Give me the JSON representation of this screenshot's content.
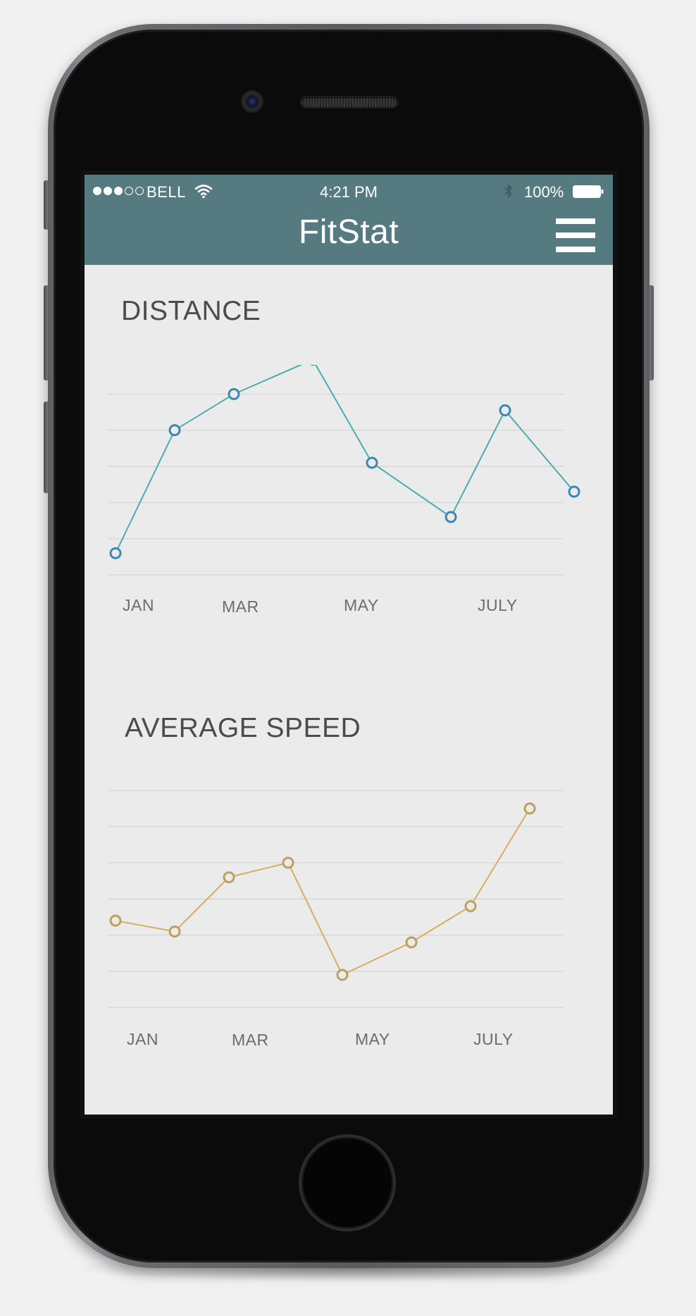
{
  "status_bar": {
    "signal": "●●●○○",
    "carrier": "BELL",
    "time": "4:21 PM",
    "battery": "100%",
    "icons": [
      "wifi-icon",
      "bluetooth-icon",
      "battery-icon"
    ]
  },
  "header": {
    "title": "FitStat",
    "menu_icon": "hamburger-menu-icon"
  },
  "colors": {
    "header_bg": "#557a80",
    "screen_bg": "#ebebeb",
    "distance_line": "#4aaeae",
    "distance_marker": "#3d87b3",
    "speed_line": "#d6ad60",
    "speed_marker": "#bca15c",
    "grid": "#d3d3d3"
  },
  "chart_data": [
    {
      "type": "line",
      "title": "DISTANCE",
      "tick_labels": [
        "JAN",
        "MAR",
        "MAY",
        "JULY"
      ],
      "grid": true,
      "ylim": [
        0,
        6
      ],
      "points": [
        {
          "x": 0.0,
          "y": 0.6
        },
        {
          "x": 1.2,
          "y": 4.0
        },
        {
          "x": 2.4,
          "y": 5.0
        },
        {
          "x": 4.0,
          "y": 5.95
        },
        {
          "x": 5.2,
          "y": 3.1
        },
        {
          "x": 6.8,
          "y": 1.6
        },
        {
          "x": 7.9,
          "y": 4.55
        },
        {
          "x": 9.3,
          "y": 2.3
        }
      ]
    },
    {
      "type": "line",
      "title": "AVERAGE SPEED",
      "tick_labels": [
        "JAN",
        "MAR",
        "MAY",
        "JULY"
      ],
      "grid": true,
      "ylim": [
        0,
        6
      ],
      "points": [
        {
          "x": 0.0,
          "y": 2.4
        },
        {
          "x": 1.2,
          "y": 2.1
        },
        {
          "x": 2.3,
          "y": 3.6
        },
        {
          "x": 3.5,
          "y": 4.0
        },
        {
          "x": 4.6,
          "y": 0.9
        },
        {
          "x": 6.0,
          "y": 1.8
        },
        {
          "x": 7.2,
          "y": 2.8
        },
        {
          "x": 8.4,
          "y": 5.5
        }
      ]
    }
  ]
}
